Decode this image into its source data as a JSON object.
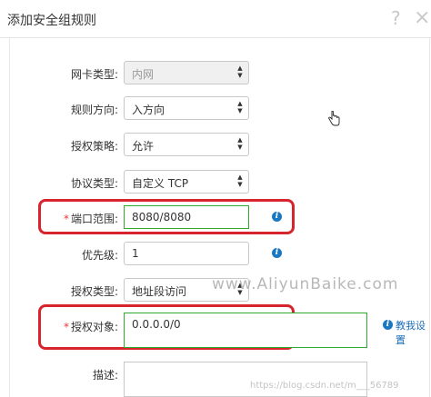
{
  "dialog": {
    "title": "添加安全组规则",
    "help_glyph": "?",
    "close_glyph": "×"
  },
  "form": {
    "nic_type": {
      "label": "网卡类型:",
      "value": "内网"
    },
    "direction": {
      "label": "规则方向:",
      "value": "入方向"
    },
    "policy": {
      "label": "授权策略:",
      "value": "允许"
    },
    "protocol": {
      "label": "协议类型:",
      "value": "自定义 TCP"
    },
    "port_range": {
      "required_mark": "*",
      "label": "端口范围:",
      "value": "8080/8080"
    },
    "priority": {
      "label": "优先级:",
      "value": "1"
    },
    "auth_type": {
      "label": "授权类型:",
      "value": "地址段访问"
    },
    "auth_object": {
      "required_mark": "*",
      "label": "授权对象:",
      "value": "0.0.0.0/0",
      "help_link": "教我设置"
    },
    "description": {
      "label": "描述:"
    }
  },
  "icons": {
    "info": "info-icon",
    "select_arrows": "updown-arrows-icon",
    "cursor": "hand-cursor-icon"
  },
  "watermarks": {
    "site": "www.AliyunBaike.com",
    "blog": "https://blog.csdn.net/m___56789"
  },
  "colors": {
    "highlight_red": "#d8242c",
    "focus_green": "#2eaa2e",
    "info_blue": "#1a78c2"
  }
}
